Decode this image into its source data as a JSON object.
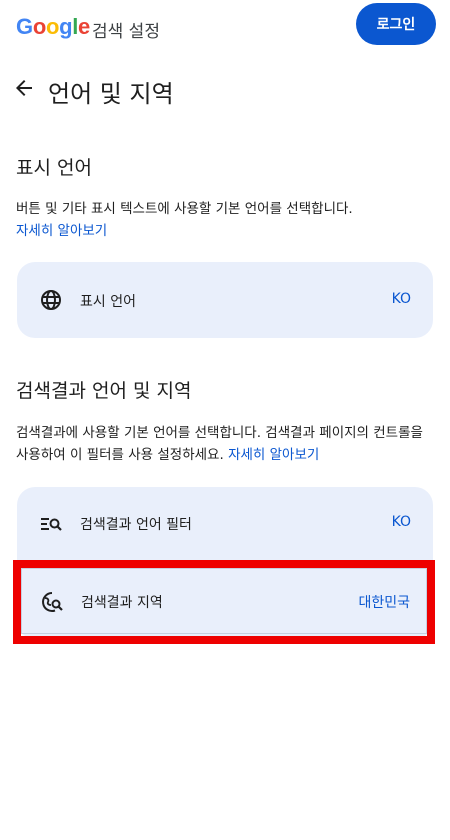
{
  "header": {
    "logo": "Google",
    "title": "검색 설정",
    "login_label": "로그인"
  },
  "page": {
    "title": "언어 및 지역"
  },
  "display_language": {
    "section_title": "표시 언어",
    "description": "버튼 및 기타 표시 텍스트에 사용할 기본 언어를 선택합니다.",
    "learn_more": "자세히 알아보기",
    "row": {
      "label": "표시 언어",
      "value": "KO",
      "icon": "globe-icon"
    }
  },
  "results_language_region": {
    "section_title": "검색결과 언어 및 지역",
    "description": "검색결과에 사용할 기본 언어를 선택합니다. 검색결과 페이지의 컨트롤을 사용하여 이 필터를 사용 설정하세요.",
    "learn_more": "자세히 알아보기",
    "rows": [
      {
        "label": "검색결과 언어 필터",
        "value": "KO",
        "icon": "language-filter-icon"
      },
      {
        "label": "검색결과 지역",
        "value": "대한민국",
        "icon": "region-search-icon"
      }
    ]
  },
  "colors": {
    "accent": "#0b57d0",
    "card": "#e9effb",
    "highlight": "#ee0000"
  }
}
